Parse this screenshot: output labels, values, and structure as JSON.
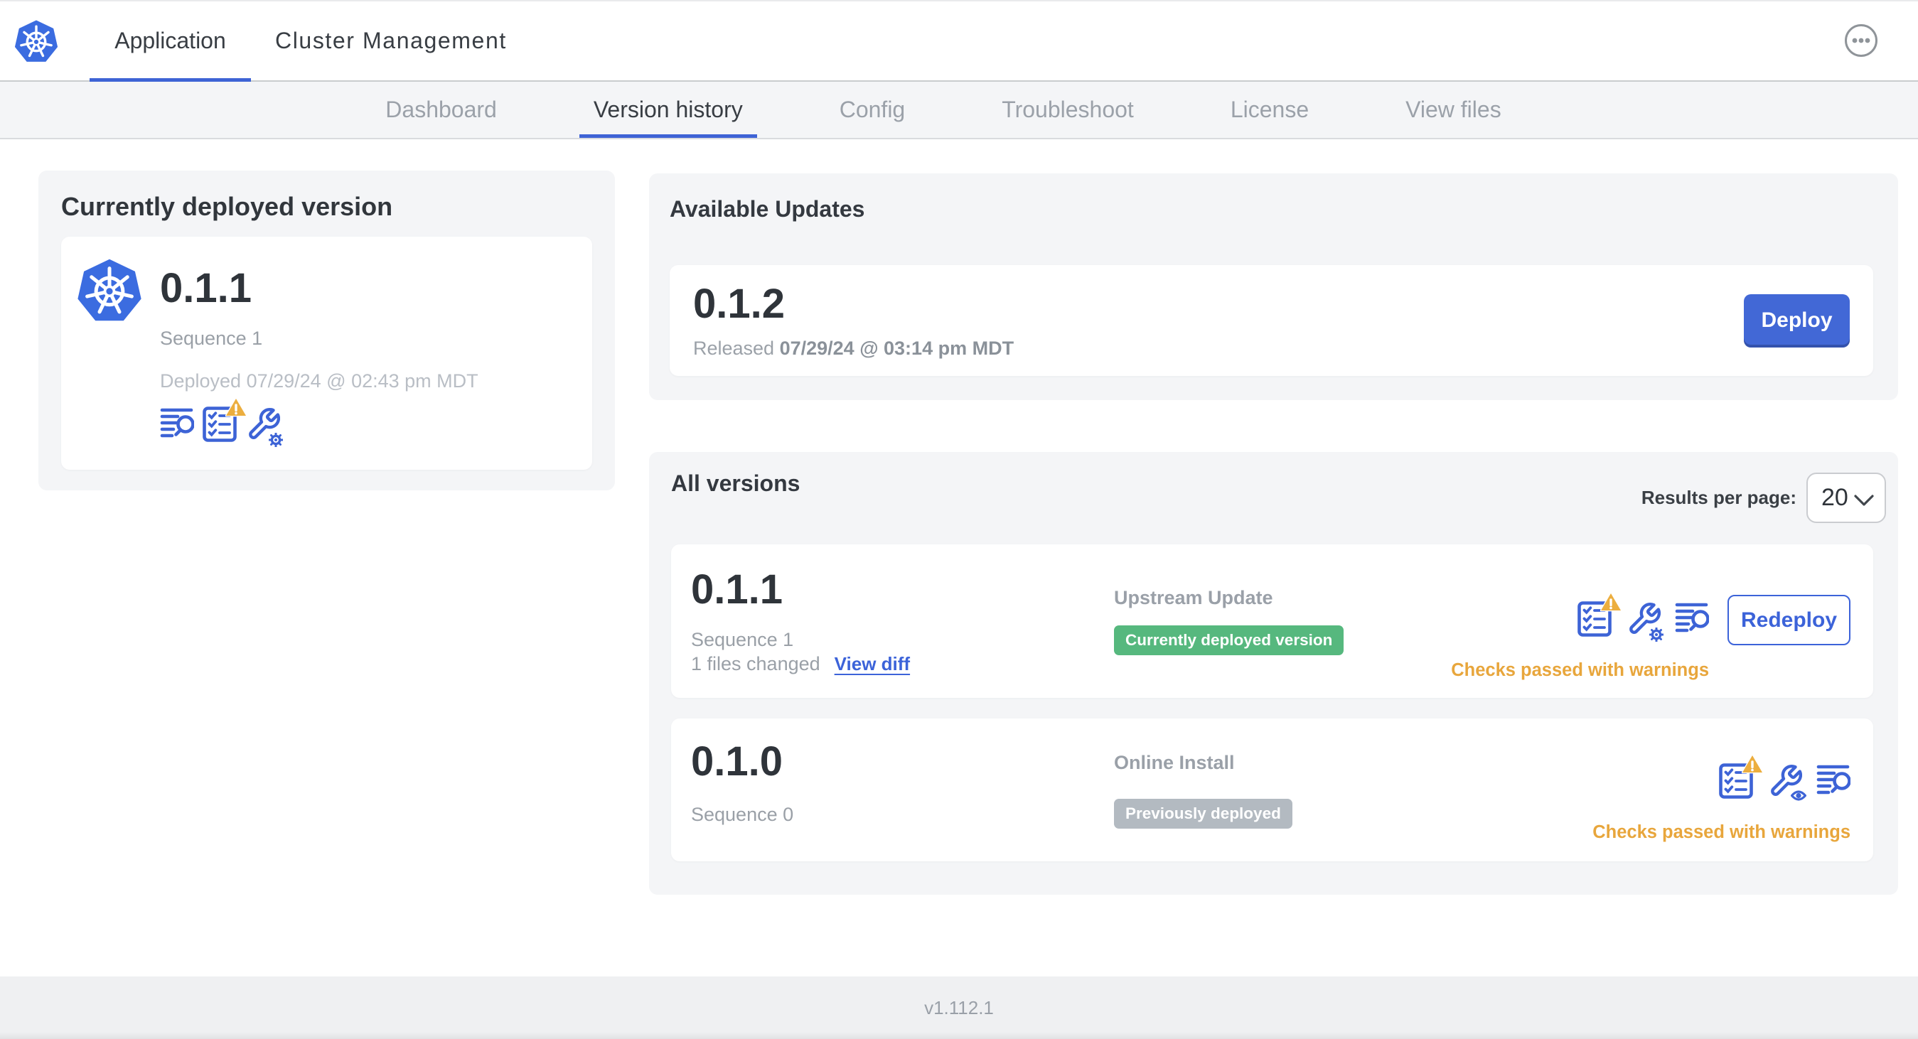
{
  "topnav": {
    "tabs": [
      {
        "label": "Application",
        "active": true
      },
      {
        "label": "Cluster Management",
        "active": false
      }
    ]
  },
  "subnav": {
    "tabs": [
      {
        "label": "Dashboard",
        "active": false
      },
      {
        "label": "Version history",
        "active": true
      },
      {
        "label": "Config",
        "active": false
      },
      {
        "label": "Troubleshoot",
        "active": false
      },
      {
        "label": "License",
        "active": false
      },
      {
        "label": "View files",
        "active": false
      }
    ]
  },
  "current": {
    "title": "Currently deployed version",
    "version": "0.1.1",
    "sequence": "Sequence 1",
    "deployed": "Deployed 07/29/24 @ 02:43 pm MDT"
  },
  "updates": {
    "title": "Available Updates",
    "version": "0.1.2",
    "released_label": "Released",
    "released_time": "07/29/24 @ 03:14 pm MDT",
    "deploy_label": "Deploy"
  },
  "all_versions": {
    "title": "All versions",
    "results_per_page_label": "Results per page:",
    "results_per_page_value": "20",
    "rows": [
      {
        "version": "0.1.1",
        "sequence": "Sequence 1",
        "files_changed": "1 files changed",
        "view_diff_label": "View diff",
        "type": "Upstream Update",
        "badge": "Currently deployed version",
        "status": "Checks passed with warnings",
        "action_label": "Redeploy"
      },
      {
        "version": "0.1.0",
        "sequence": "Sequence 0",
        "type": "Online Install",
        "badge": "Previously deployed",
        "status": "Checks passed with warnings"
      }
    ]
  },
  "footer": {
    "version_label": "v1.112.1"
  },
  "colors": {
    "primary_blue": "#3e63d5",
    "button_blue": "#4268d6",
    "badge_green": "#56b87e",
    "badge_gray": "#b3bac1",
    "warning_amber": "#e8a63c",
    "panel_gray": "#f4f5f7"
  }
}
